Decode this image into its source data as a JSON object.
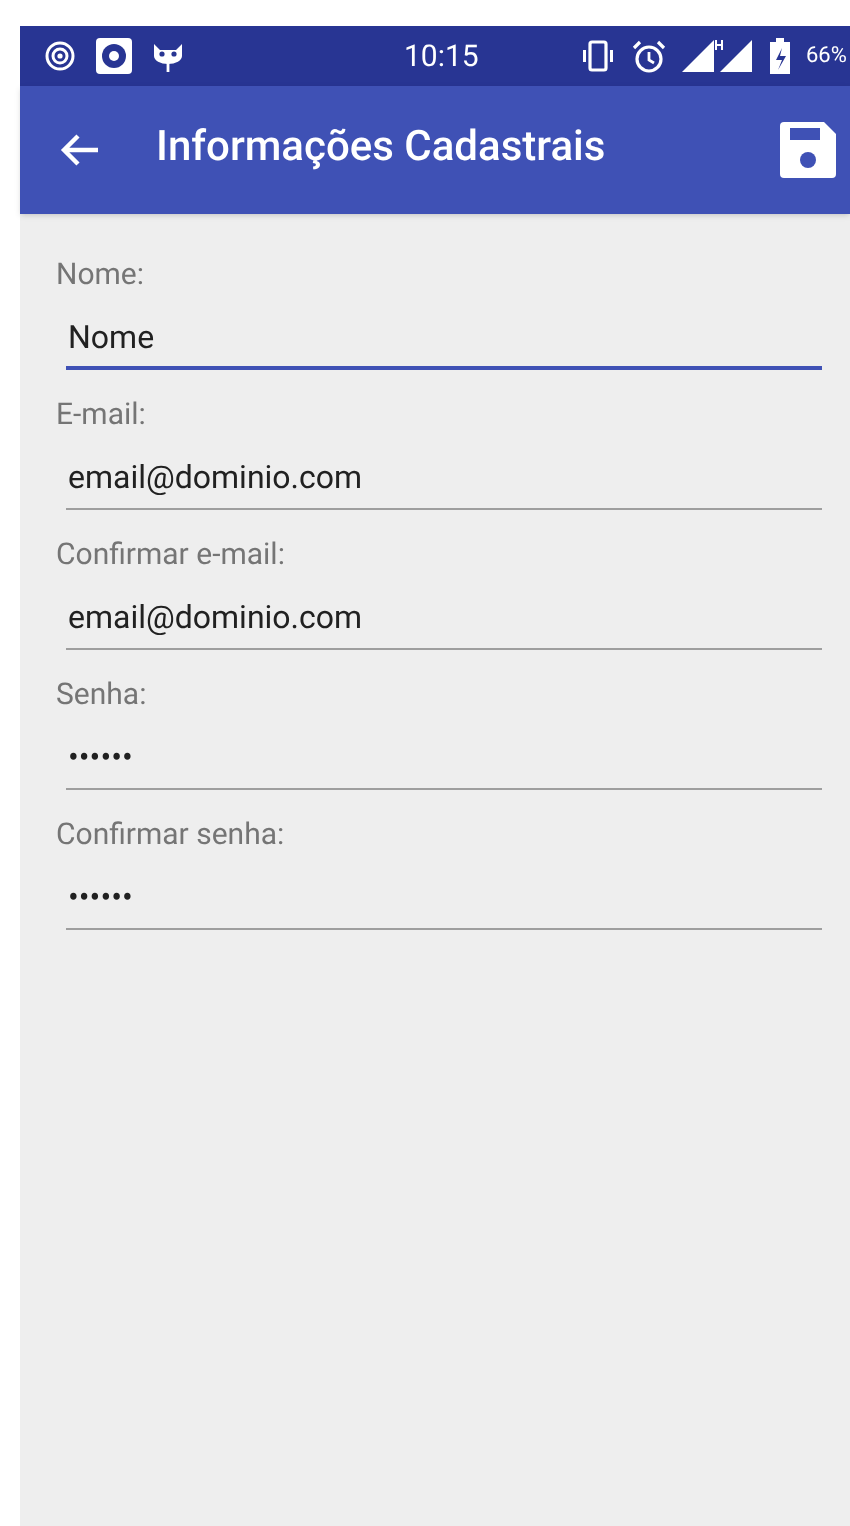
{
  "status_bar": {
    "time": "10:15",
    "battery": "66%"
  },
  "app_bar": {
    "title": "Informações Cadastrais"
  },
  "fields": [
    {
      "label": "Nome:",
      "value": "Nome",
      "focused": true
    },
    {
      "label": "E-mail:",
      "value": "email@dominio.com",
      "focused": false
    },
    {
      "label": "Confirmar e-mail:",
      "value": "email@dominio.com",
      "focused": false
    },
    {
      "label": "Senha:",
      "value": "••••••",
      "focused": false
    },
    {
      "label": "Confirmar senha:",
      "value": "••••••",
      "focused": false
    }
  ]
}
